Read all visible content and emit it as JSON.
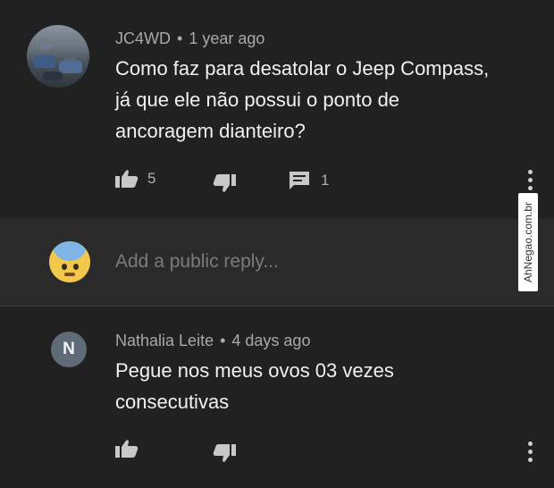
{
  "comment1": {
    "author": "JC4WD",
    "time": "1 year ago",
    "text_line1": "Como faz para desatolar o Jeep Compass,",
    "text_line2": "já que ele não possui o ponto de",
    "text_line3": "ancoragem dianteiro?",
    "likes": "5",
    "replies": "1"
  },
  "reply_box": {
    "placeholder": "Add a public reply..."
  },
  "comment2": {
    "avatar_letter": "N",
    "author": "Nathalia Leite",
    "time": "4 days ago",
    "text_line1": "Pegue nos meus ovos 03 vezes",
    "text_line2": "consecutivas"
  },
  "watermark": {
    "text": "AhNegao.com.br"
  },
  "meta_separator": "•",
  "icons": [
    "like-icon",
    "dislike-icon",
    "reply-icon",
    "more-vert-icon"
  ],
  "colors": {
    "background": "#212121",
    "reply_background": "#2a2a2a",
    "meta_text": "#a9a9a9",
    "body_text": "#f1f1f1"
  }
}
